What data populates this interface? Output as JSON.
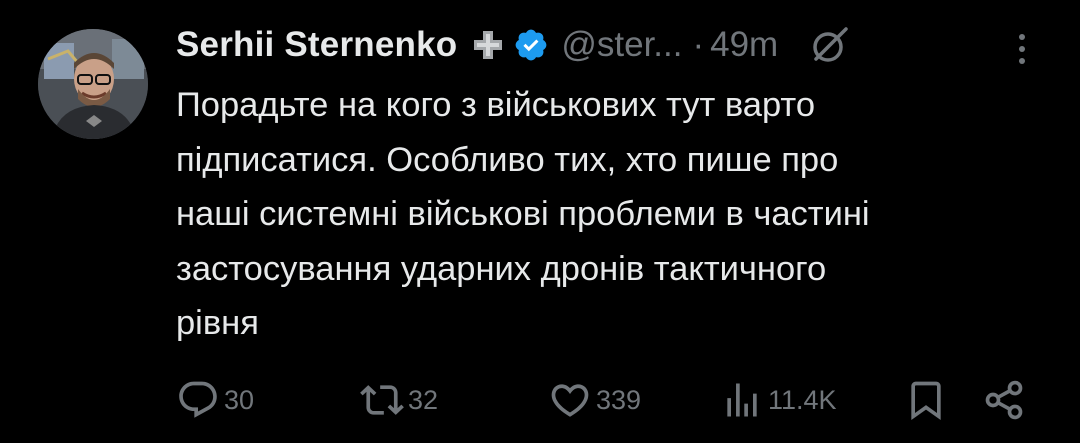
{
  "author": {
    "name": "Serhii Sternenko",
    "handle": "@ster...",
    "separator": "·",
    "time": "49m",
    "avatar_icon": "avatar-photo",
    "badges": [
      "cross-badge-icon",
      "verified-badge-icon"
    ]
  },
  "tweet": {
    "text": "Порадьте на кого з військових тут варто\nпідписатися. Особливо тих, хто пише про\nнаші системні військові проблеми в частині\nзастосування ударних дронів тактичного\nрівня"
  },
  "actions": {
    "replies": "30",
    "reposts": "32",
    "likes": "339",
    "views": "11.4K"
  },
  "colors": {
    "background": "#000000",
    "text": "#e7e9ea",
    "secondary": "#71767b",
    "verified": "#1d9bf0"
  }
}
